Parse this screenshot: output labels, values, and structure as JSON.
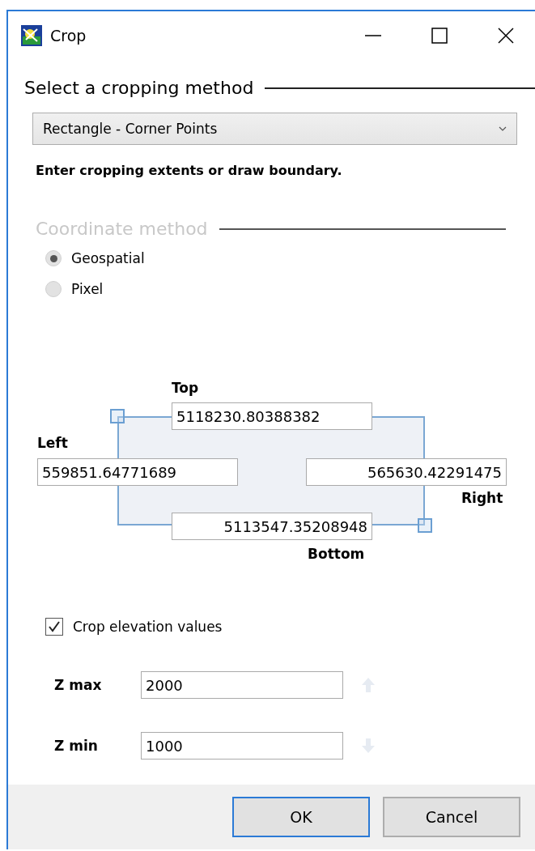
{
  "window": {
    "title": "Crop"
  },
  "method_section": {
    "title": "Select a cropping method",
    "dropdown": {
      "value": "Rectangle - Corner Points"
    },
    "instruction": "Enter cropping extents or draw boundary."
  },
  "coordinate_section": {
    "title": "Coordinate method",
    "disabled": true,
    "options": [
      {
        "label": "Geospatial",
        "selected": true
      },
      {
        "label": "Pixel",
        "selected": false
      }
    ]
  },
  "extents": {
    "top": {
      "label": "Top",
      "value": "5118230.80388382"
    },
    "left": {
      "label": "Left",
      "value": "559851.64771689"
    },
    "right": {
      "label": "Right",
      "value": "565630.42291475"
    },
    "bottom": {
      "label": "Bottom",
      "value": "5113547.35208948"
    }
  },
  "elevation": {
    "label": "Crop elevation values",
    "checked": true,
    "fields": [
      {
        "label": "Z max",
        "value": "2000",
        "kind": "up"
      },
      {
        "label": "Z min",
        "value": "1000",
        "kind": "down"
      }
    ]
  },
  "buttons": [
    {
      "label": "OK",
      "default": true
    },
    {
      "label": "Cancel",
      "default": false
    }
  ]
}
